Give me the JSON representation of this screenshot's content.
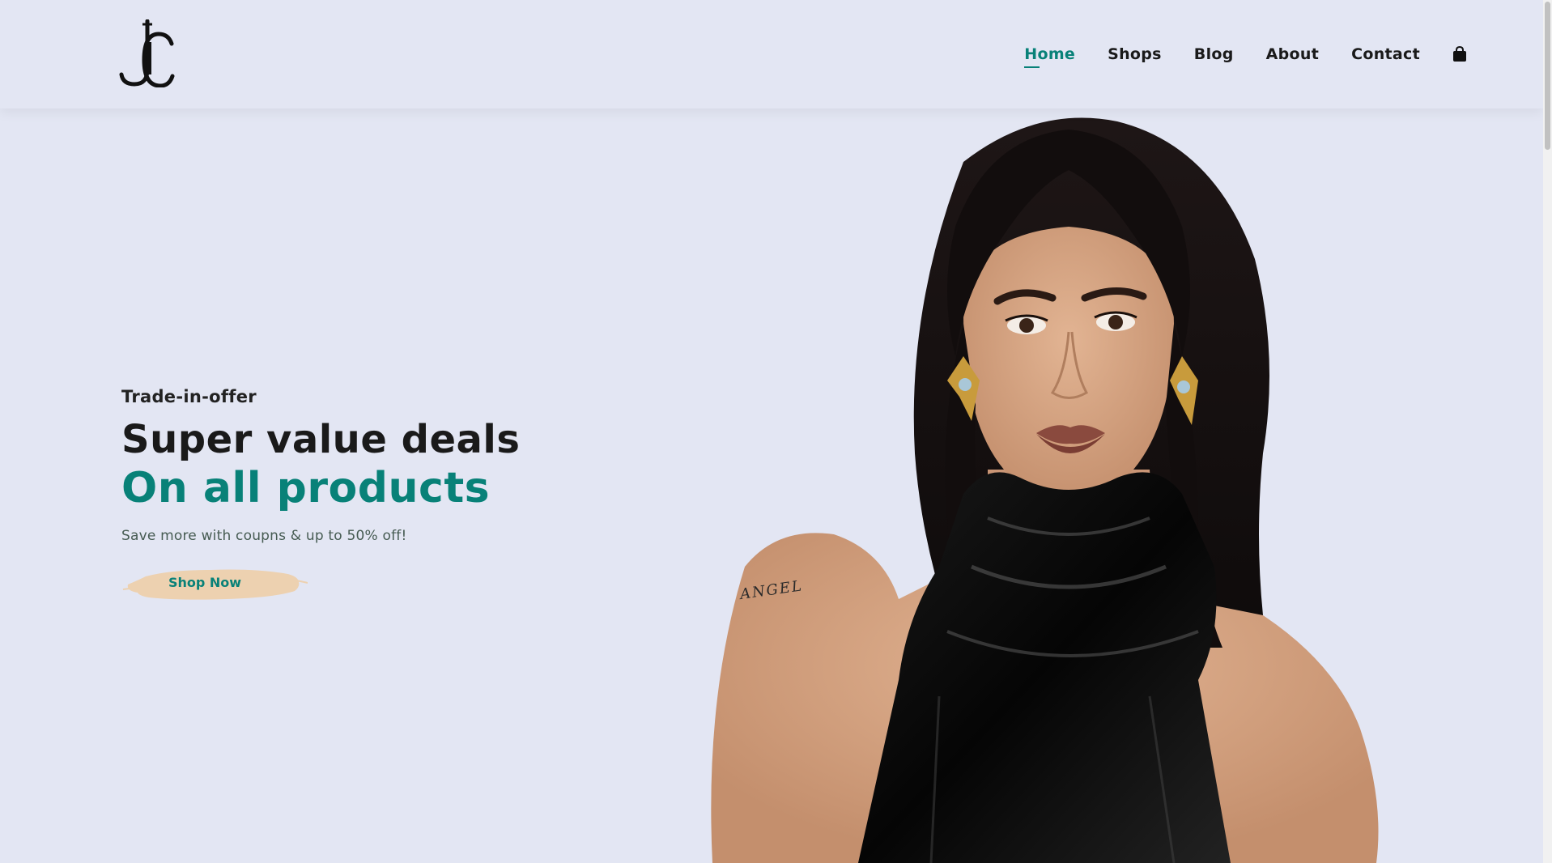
{
  "header": {
    "logo_icon": "jc-monogram-logo",
    "nav": [
      {
        "label": "Home",
        "active": true
      },
      {
        "label": "Shops",
        "active": false
      },
      {
        "label": "Blog",
        "active": false
      },
      {
        "label": "About",
        "active": false
      },
      {
        "label": "Contact",
        "active": false
      }
    ],
    "cart_icon": "shopping-bag-icon"
  },
  "hero": {
    "kicker": "Trade-in-offer",
    "title": "Super value deals",
    "title_accent": "On all products",
    "subtitle": "Save more with coupns & up to 50% off!",
    "button_label": "Shop Now",
    "photo_text": "ANGEL"
  },
  "colors": {
    "background": "#E3E6F3",
    "accent": "#088178",
    "button_brush": "#EDD1B0",
    "text": "#1a1a1a"
  }
}
